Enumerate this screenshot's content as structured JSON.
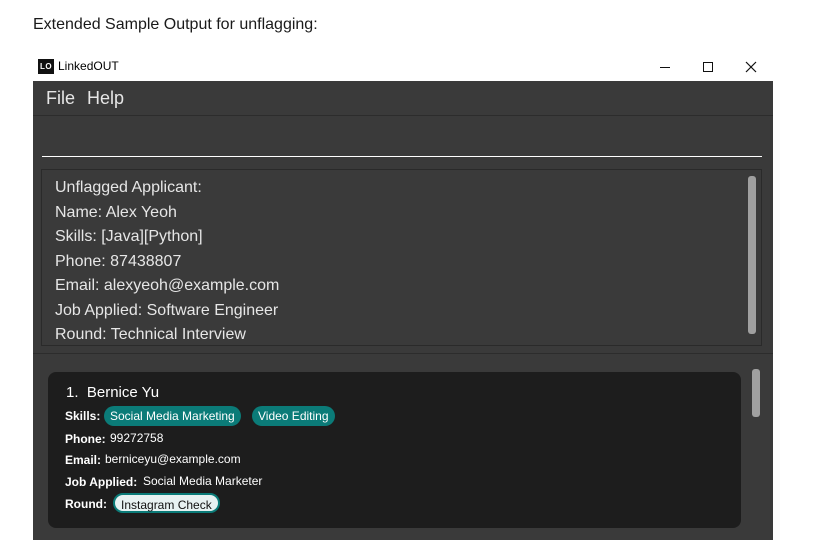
{
  "caption": "Extended Sample Output for unflagging:",
  "window": {
    "logo_text": "LO",
    "title": "LinkedOUT"
  },
  "menu": {
    "file": "File",
    "help": "Help"
  },
  "command_input": {
    "value": ""
  },
  "result": {
    "lines": [
      "Unflagged Applicant:",
      "Name: Alex Yeoh",
      "Skills: [Java][Python]",
      "Phone: 87438807",
      "Email: alexyeoh@example.com",
      "Job Applied: Software Engineer",
      "Round: Technical Interview"
    ]
  },
  "applicants": [
    {
      "index": "1.",
      "name": "Bernice Yu",
      "skills_label": "Skills:",
      "skills": [
        "Social Media Marketing",
        "Video Editing"
      ],
      "phone_label": "Phone:",
      "phone": "99272758",
      "email_label": "Email:",
      "email": "berniceyu@example.com",
      "job_label": "Job Applied:",
      "job": "Social Media Marketer",
      "round_label": "Round:",
      "round": "Instagram Check"
    }
  ],
  "colors": {
    "skill_tag": "#0b7b78",
    "round_tag_bg": "#e8f2f2",
    "round_tag_border": "#0b7b78",
    "round_tag_text": "#111111"
  }
}
